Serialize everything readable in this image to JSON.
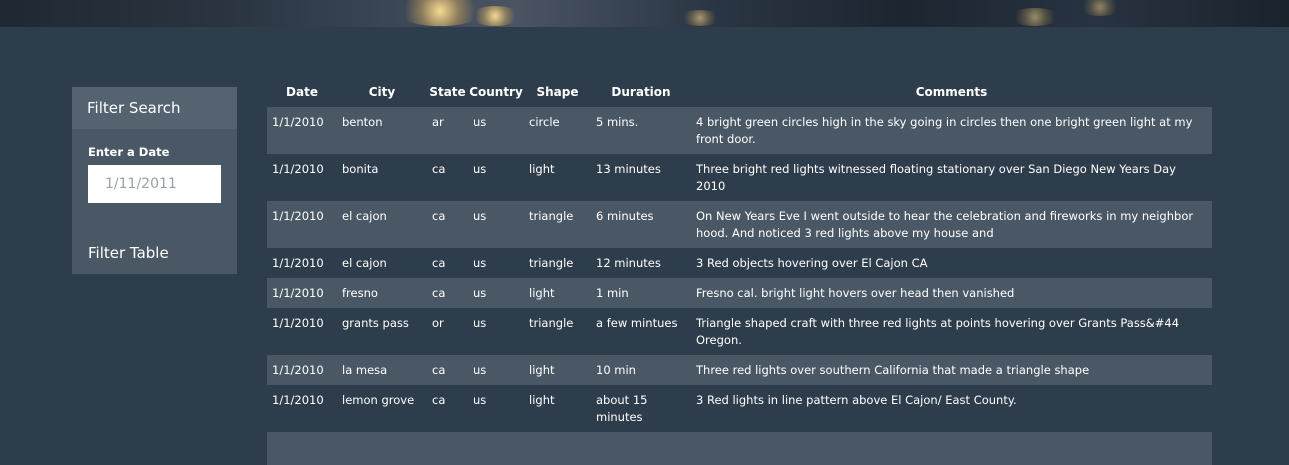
{
  "sidebar": {
    "title": "Filter Search",
    "date_label": "Enter a Date",
    "date_placeholder": "1/11/2011",
    "filter_button": "Filter Table"
  },
  "table": {
    "headers": [
      "Date",
      "City",
      "State",
      "Country",
      "Shape",
      "Duration",
      "Comments"
    ],
    "rows": [
      [
        "1/1/2010",
        "benton",
        "ar",
        "us",
        "circle",
        "5 mins.",
        "4 bright green circles high in the sky going in circles then one bright green light at my front door."
      ],
      [
        "1/1/2010",
        "bonita",
        "ca",
        "us",
        "light",
        "13 minutes",
        "Three bright red lights witnessed floating stationary over San Diego New Years Day 2010"
      ],
      [
        "1/1/2010",
        "el cajon",
        "ca",
        "us",
        "triangle",
        "6 minutes",
        "On New Years Eve I went outside to hear the celebration and fireworks in my neighbor hood. And noticed 3 red lights above my house and"
      ],
      [
        "1/1/2010",
        "el cajon",
        "ca",
        "us",
        "triangle",
        "12 minutes",
        "3 Red objects hovering over El Cajon CA"
      ],
      [
        "1/1/2010",
        "fresno",
        "ca",
        "us",
        "light",
        "1 min",
        "Fresno cal. bright light hovers over head then vanished"
      ],
      [
        "1/1/2010",
        "grants pass",
        "or",
        "us",
        "triangle",
        "a few mintues",
        "Triangle shaped craft with three red lights at points hovering over Grants Pass&#44 Oregon."
      ],
      [
        "1/1/2010",
        "la mesa",
        "ca",
        "us",
        "light",
        "10 min",
        "Three red lights over southern California that made a triangle shape"
      ],
      [
        "1/1/2010",
        "lemon grove",
        "ca",
        "us",
        "light",
        "about 15 minutes",
        "3 Red lights in line pattern above El Cajon/ East County."
      ]
    ]
  }
}
